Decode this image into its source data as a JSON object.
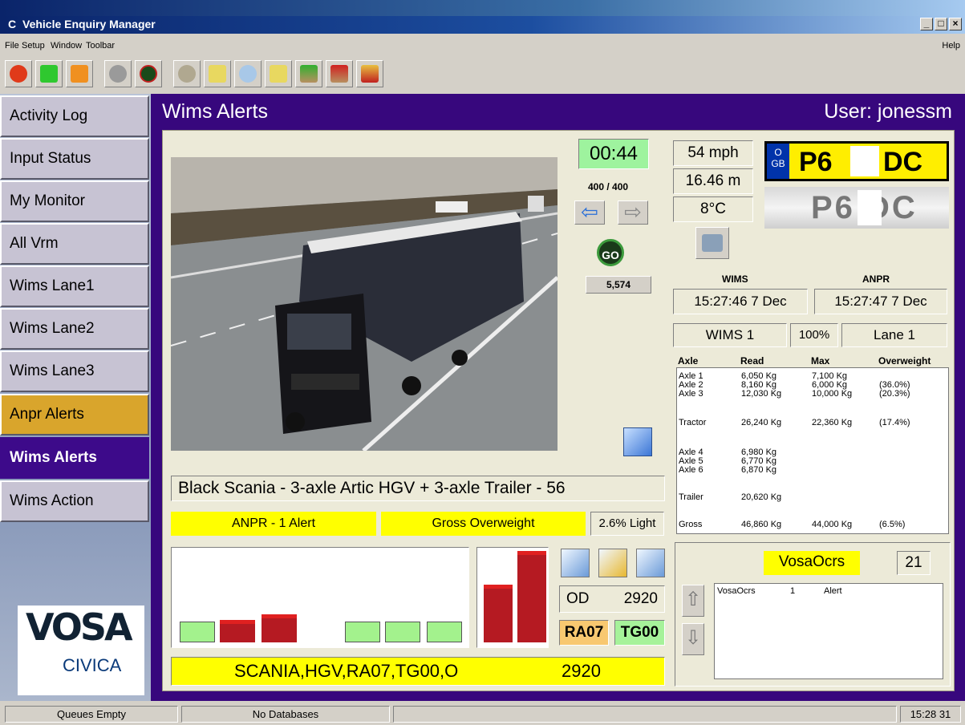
{
  "window": {
    "title": "Vehicle Enquiry Manager",
    "min": "_",
    "max": "□",
    "close": "×"
  },
  "menu": {
    "file": "File",
    "setup": "Setup",
    "window": "Window",
    "toolbar": "Toolbar",
    "help": "Help"
  },
  "toolbar_icons": [
    "power-icon",
    "key-green-icon",
    "key-orange-icon",
    "disc-icon",
    "go-stop-icon",
    "disc-gear-icon",
    "settings-chip-icon",
    "cd-icon",
    "scanner-icon",
    "download-icon",
    "upload-icon",
    "car-folder-icon"
  ],
  "sidebar": {
    "items": [
      {
        "label": "Activity Log"
      },
      {
        "label": "Input Status"
      },
      {
        "label": "My Monitor"
      },
      {
        "label": "All Vrm"
      },
      {
        "label": "Wims Lane1"
      },
      {
        "label": "Wims Lane2"
      },
      {
        "label": "Wims Lane3"
      },
      {
        "label": "Anpr Alerts"
      },
      {
        "label": "Wims Alerts"
      },
      {
        "label": "Wims Action"
      }
    ],
    "logo_main": "VOSA",
    "logo_sub": "CIVICA"
  },
  "header": {
    "title": "Wims Alerts",
    "user": "User: jonessm"
  },
  "nav": {
    "timer": "00:44",
    "count": "400 / 400",
    "go": "GO",
    "number": "5,574"
  },
  "vehicle": {
    "description": "Black Scania  -  3-axle Artic HGV + 3-axle Trailer - 56",
    "anpr_alert": "ANPR - 1 Alert",
    "gross": "Gross Overweight",
    "light": "2.6% Light",
    "speed": "54 mph",
    "length": "16.46 m",
    "temp": "8°C",
    "plate_left": "P6",
    "plate_right": "DC",
    "plate_country_top": "O",
    "plate_country": "GB",
    "anpr_plate": "P6   DC"
  },
  "times": {
    "wims_label": "WIMS",
    "anpr_label": "ANPR",
    "wims_time": "15:27:46  7 Dec",
    "anpr_time": "15:27:47  7 Dec",
    "station": "WIMS 1",
    "pct": "100%",
    "lane": "Lane 1"
  },
  "axle_headers": {
    "axle": "Axle",
    "read": "Read",
    "max": "Max",
    "over": "Overweight"
  },
  "axles": [
    {
      "axle": "Axle 1",
      "read": "6,050 Kg",
      "max": "7,100 Kg",
      "over": ""
    },
    {
      "axle": "Axle 2",
      "read": "8,160 Kg",
      "max": "6,000 Kg",
      "over": "(36.0%)"
    },
    {
      "axle": "Axle 3",
      "read": "12,030 Kg",
      "max": "10,000 Kg",
      "over": "(20.3%)"
    },
    {
      "axle": "Tractor",
      "read": "26,240 Kg",
      "max": "22,360 Kg",
      "over": "(17.4%)"
    },
    {
      "axle": "Axle 4",
      "read": "6,980 Kg",
      "max": "",
      "over": ""
    },
    {
      "axle": "Axle 5",
      "read": "6,770 Kg",
      "max": "",
      "over": ""
    },
    {
      "axle": "Axle 6",
      "read": "6,870 Kg",
      "max": "",
      "over": ""
    },
    {
      "axle": "Trailer",
      "read": "20,620 Kg",
      "max": "",
      "over": ""
    },
    {
      "axle": "Gross",
      "read": "46,860 Kg",
      "max": "44,000 Kg",
      "over": "(6.5%)"
    }
  ],
  "od": {
    "label": "OD",
    "value": "2920"
  },
  "codes": {
    "ra": "RA07",
    "tg": "TG00"
  },
  "bottom_line": {
    "text": "SCANIA,HGV,RA07,TG00,O",
    "value": "2920"
  },
  "vosa_panel": {
    "title": "VosaOcrs",
    "count": "21",
    "row_name": "VosaOcrs",
    "row_num": "1",
    "row_type": "Alert"
  },
  "status": {
    "queues": "Queues Empty",
    "db": "No Databases",
    "clock": "15:28  31"
  },
  "chart_data": [
    {
      "type": "bar",
      "categories": [
        "1",
        "2",
        "3",
        "4",
        "5",
        "6",
        "7"
      ],
      "values": [
        0.22,
        0.24,
        0.3,
        0,
        0.22,
        0.22,
        0.22
      ],
      "colors": [
        "#a3f28d",
        "#b51a22",
        "#b51a22",
        "",
        "#a3f28d",
        "#a3f28d",
        "#a3f28d"
      ],
      "ylim": [
        0,
        1
      ]
    },
    {
      "type": "bar",
      "categories": [
        "1",
        "2"
      ],
      "values": [
        0.62,
        0.98
      ],
      "colors": [
        "#b51a22",
        "#b51a22"
      ],
      "ylim": [
        0,
        1
      ]
    }
  ]
}
